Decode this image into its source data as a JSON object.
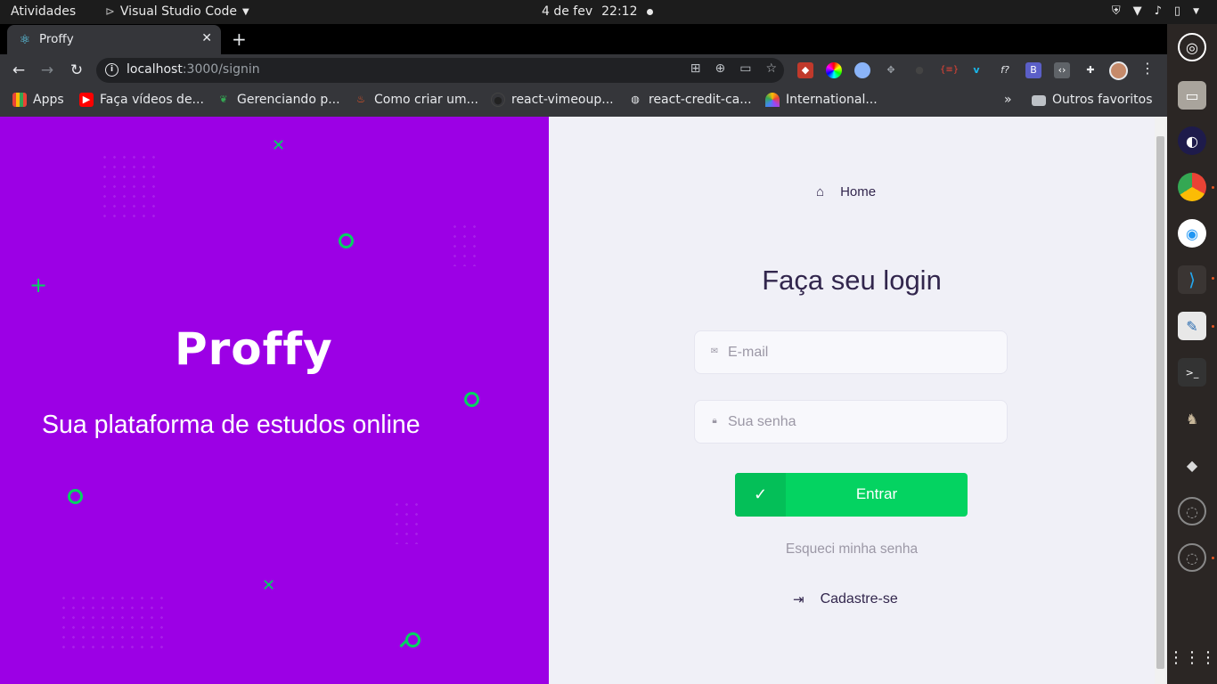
{
  "system_bar": {
    "activities": "Atividades",
    "app_name": "Visual Studio Code",
    "date": "4 de fev",
    "time": "22:12"
  },
  "browser": {
    "tab_title": "Proffy",
    "url_host": "localhost",
    "url_path": ":3000/signin",
    "bookmarks": [
      {
        "label": "Apps",
        "icon": "apps-grid-icon"
      },
      {
        "label": "Faça vídeos de...",
        "icon": "youtube-icon"
      },
      {
        "label": "Gerenciando p...",
        "icon": "leaf-icon"
      },
      {
        "label": "Como criar um...",
        "icon": "flame-icon"
      },
      {
        "label": "react-vimeoup...",
        "icon": "github-icon"
      },
      {
        "label": "react-credit-ca...",
        "icon": "globe-icon"
      },
      {
        "label": "International...",
        "icon": "nbc-icon"
      }
    ],
    "other_bookmarks": "Outros favoritos",
    "more_bookmarks": "»"
  },
  "brand": {
    "logo": "Proffy",
    "tagline": "Sua plataforma de estudos online"
  },
  "login": {
    "home_link": "Home",
    "title": "Faça seu login",
    "email_placeholder": "E-mail",
    "password_placeholder": "Sua senha",
    "submit_label": "Entrar",
    "forgot_password": "Esqueci minha senha",
    "signup_link": "Cadastre-se"
  },
  "colors": {
    "brand_purple": "#9c00e5",
    "accent_green": "#04d361",
    "form_background": "#f0f0f7",
    "title_text": "#32264d"
  }
}
